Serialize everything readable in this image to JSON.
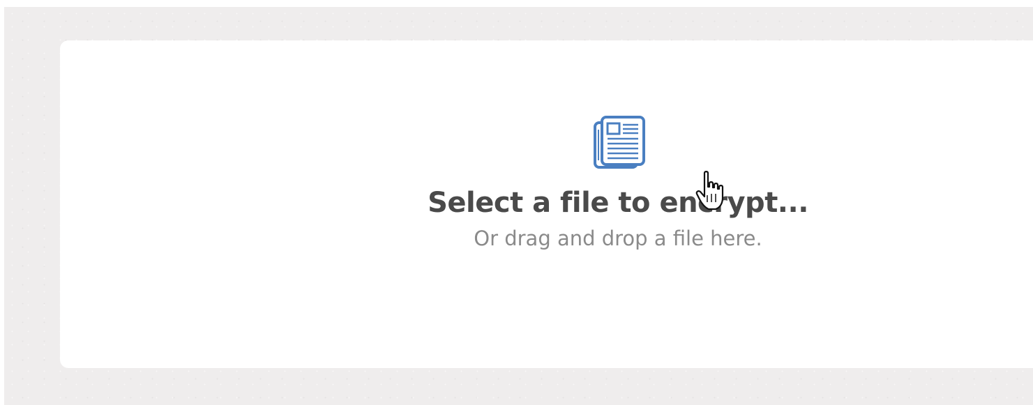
{
  "dropzone": {
    "icon": "file-document-icon",
    "title": "Select a file to encrypt...",
    "subtitle": "Or drag and drop a file here."
  },
  "cursor": {
    "icon": "hand-pointer-cursor-icon"
  },
  "colors": {
    "icon_blue": "#4a7fc1",
    "title_text": "#4a4a4a",
    "subtitle_text": "#8a8a8a",
    "backdrop": "#efeded",
    "card": "#ffffff"
  }
}
